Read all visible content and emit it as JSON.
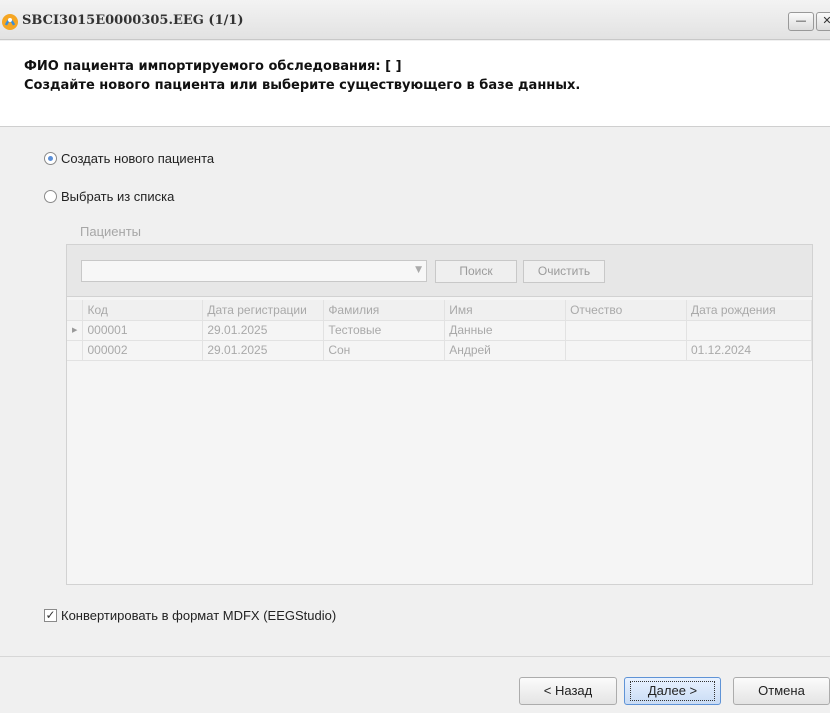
{
  "window": {
    "title": "SBCI3015E0000305.EEG (1/1)"
  },
  "header": {
    "line1": "ФИО пациента импортируемого обследования: [ ]",
    "line2": "Создайте нового пациента или выберите существующего в базе данных."
  },
  "options": {
    "create_new": {
      "label": "Создать нового пациента",
      "checked": true
    },
    "select_from_list": {
      "label": "Выбрать из списка",
      "checked": false
    }
  },
  "patients": {
    "group_label": "Пациенты",
    "search_combo_value": "",
    "search_button": "Поиск",
    "clear_button": "Очистить",
    "columns": [
      "Код",
      "Дата регистрации",
      "Фамилия",
      "Имя",
      "Отчество",
      "Дата рождения"
    ],
    "rows": [
      [
        "000001",
        "29.01.2025",
        "Тестовые",
        "Данные",
        "",
        ""
      ],
      [
        "000002",
        "29.01.2025",
        "Сон",
        "Андрей",
        "",
        "01.12.2024"
      ]
    ]
  },
  "convert": {
    "label": "Конвертировать в формат MDFX (EEGStudio)",
    "checked": true
  },
  "footer": {
    "back": "< Назад",
    "next": "Далее >",
    "cancel": "Отмена"
  },
  "colors": {
    "accent": "#5f93d6",
    "disabled_text": "#a9a9a9"
  }
}
